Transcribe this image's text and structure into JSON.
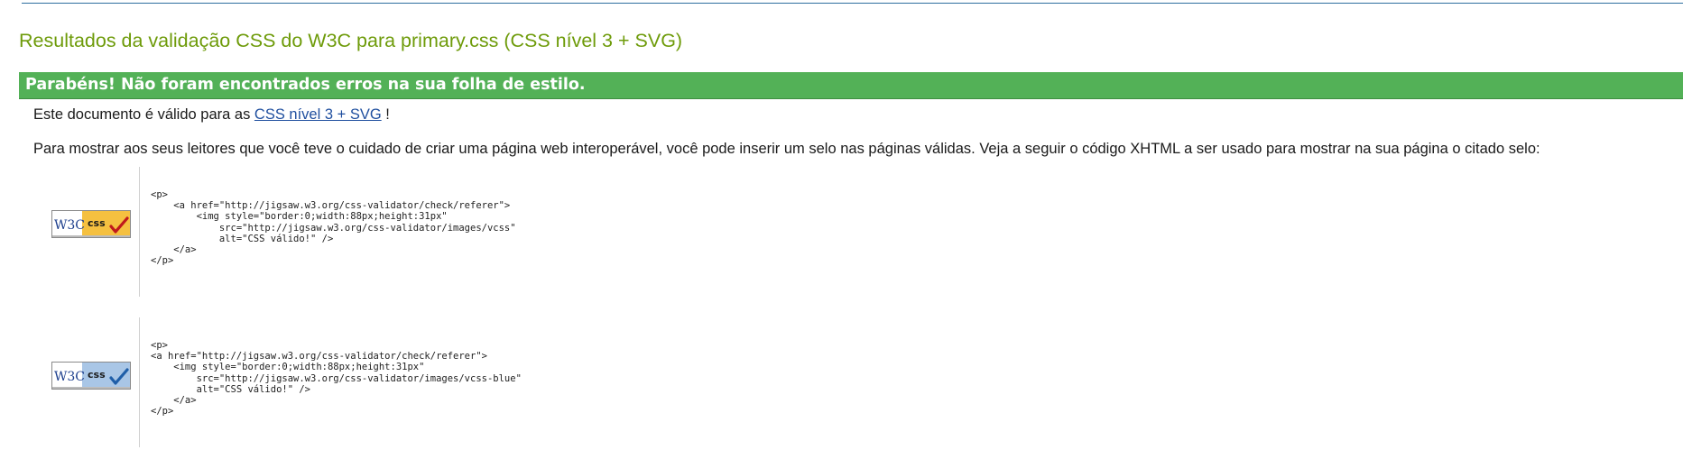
{
  "page": {
    "title": "Resultados da validação CSS do W3C para primary.css (CSS nível 3 + SVG)",
    "success_message": "Parabéns! Não foram encontrados erros na sua folha de estilo.",
    "valid_prefix": "Este documento é válido para as ",
    "valid_link": "CSS nível 3 + SVG",
    "valid_suffix": " !",
    "info_text": "Para mostrar aos seus leitores que você teve o cuidado de criar uma página web interoperável, você pode inserir um selo nas páginas válidas. Veja a seguir o código XHTML a ser usado para mostrar na sua página o citado selo:"
  },
  "badges": [
    {
      "w3c_text": "W3C",
      "css_text": "css",
      "color": "#f5c040",
      "check_color": "#c0181c",
      "code": "<p>\n    <a href=\"http://jigsaw.w3.org/css-validator/check/referer\">\n        <img style=\"border:0;width:88px;height:31px\"\n            src=\"http://jigsaw.w3.org/css-validator/images/vcss\"\n            alt=\"CSS válido!\" />\n    </a>\n</p>"
    },
    {
      "w3c_text": "W3C",
      "css_text": "css",
      "color": "#a9c6e6",
      "check_color": "#1f5ea8",
      "code": "<p>\n<a href=\"http://jigsaw.w3.org/css-validator/check/referer\">\n    <img style=\"border:0;width:88px;height:31px\"\n        src=\"http://jigsaw.w3.org/css-validator/images/vcss-blue\"\n        alt=\"CSS válido!\" />\n    </a>\n</p>"
    }
  ]
}
